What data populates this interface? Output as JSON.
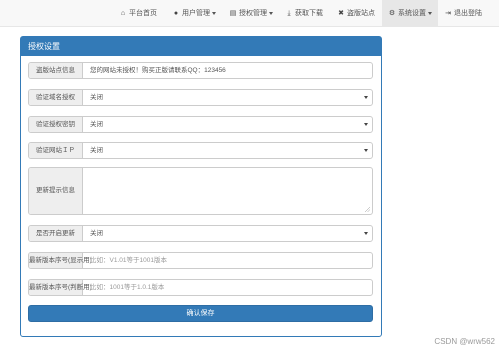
{
  "nav": {
    "items": [
      {
        "label": "平台首页",
        "icon": "home-icon",
        "glyph": "⌂"
      },
      {
        "label": "用户管理",
        "icon": "user-icon",
        "glyph": "👤",
        "dropdown": true
      },
      {
        "label": "授权管理",
        "icon": "list-icon",
        "glyph": "▤",
        "dropdown": true
      },
      {
        "label": "获取下载",
        "icon": "download-icon",
        "glyph": "⤓"
      },
      {
        "label": "盗版站点",
        "icon": "close-icon",
        "glyph": "✖"
      },
      {
        "label": "系统设置",
        "icon": "gear-icon",
        "glyph": "⚙",
        "dropdown": true,
        "active": true
      },
      {
        "label": "退出登陆",
        "icon": "logout-icon",
        "glyph": "⇥"
      }
    ]
  },
  "panel": {
    "title": "授权设置"
  },
  "form": {
    "piracy_info": {
      "label": "盗版站点信息",
      "value": "您的网站未授权！购买正版请联系QQ：123456"
    },
    "domain_auth": {
      "label": "验证域名授权",
      "value": "关闭"
    },
    "auth_key": {
      "label": "验证授权密钥",
      "value": "关闭"
    },
    "site_ip": {
      "label": "验证网站ＩＰ",
      "value": "关闭"
    },
    "update_msg": {
      "label": "更新提示信息",
      "value": ""
    },
    "enable_update": {
      "label": "是否开启更新",
      "value": "关闭"
    },
    "version_display": {
      "label": "最新版本序号(显示用)",
      "placeholder": "比如：V1.01等于1001版本"
    },
    "version_check": {
      "label": "最新版本序号(判断用)",
      "placeholder": "比如：1001等于1.0.1版本"
    },
    "submit_label": "确认保存"
  },
  "watermark": "CSDN @wrw562"
}
